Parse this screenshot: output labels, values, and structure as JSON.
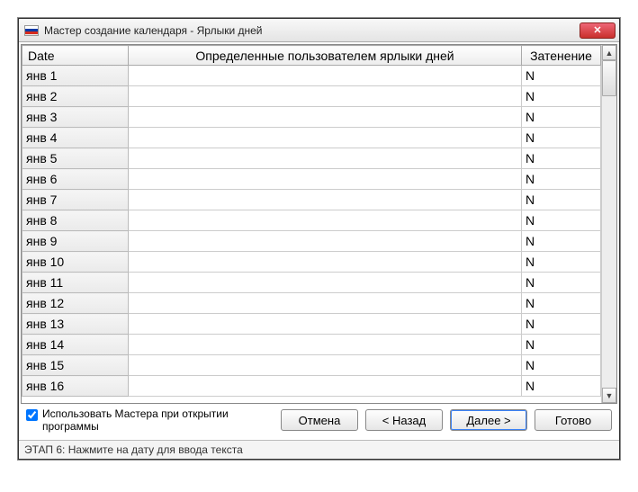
{
  "window": {
    "title": "Мастер создание календаря - Ярлыки дней"
  },
  "table": {
    "headers": {
      "date": "Date",
      "labels": "Определенные пользователем ярлыки дней",
      "shading": "Затенение"
    },
    "rows": [
      {
        "date": "янв 1",
        "label": "",
        "shade": "N"
      },
      {
        "date": "янв 2",
        "label": "",
        "shade": "N"
      },
      {
        "date": "янв 3",
        "label": "",
        "shade": "N"
      },
      {
        "date": "янв 4",
        "label": "",
        "shade": "N"
      },
      {
        "date": "янв 5",
        "label": "",
        "shade": "N"
      },
      {
        "date": "янв 6",
        "label": "",
        "shade": "N"
      },
      {
        "date": "янв 7",
        "label": "",
        "shade": "N"
      },
      {
        "date": "янв 8",
        "label": "",
        "shade": "N"
      },
      {
        "date": "янв 9",
        "label": "",
        "shade": "N"
      },
      {
        "date": "янв 10",
        "label": "",
        "shade": "N"
      },
      {
        "date": "янв 11",
        "label": "",
        "shade": "N"
      },
      {
        "date": "янв 12",
        "label": "",
        "shade": "N"
      },
      {
        "date": "янв 13",
        "label": "",
        "shade": "N"
      },
      {
        "date": "янв 14",
        "label": "",
        "shade": "N"
      },
      {
        "date": "янв 15",
        "label": "",
        "shade": "N"
      },
      {
        "date": "янв 16",
        "label": "",
        "shade": "N"
      }
    ]
  },
  "footer": {
    "checkbox_label": "Использовать Мастера при открытии программы",
    "checkbox_checked": true,
    "buttons": {
      "cancel": "Отмена",
      "back": "< Назад",
      "next": "Далее >",
      "finish": "Готово"
    }
  },
  "status": "ЭТАП 6: Нажмите на дату для ввода текста"
}
